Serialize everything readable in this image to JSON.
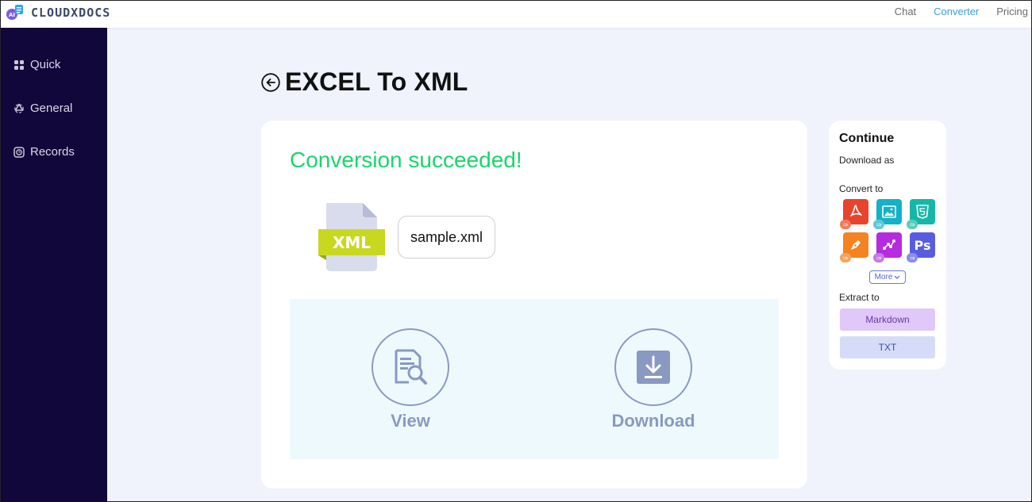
{
  "header": {
    "brand": "CLOUDXDOCS",
    "nav": [
      {
        "label": "Chat",
        "active": false
      },
      {
        "label": "Converter",
        "active": true
      },
      {
        "label": "Pricing",
        "active": false
      }
    ]
  },
  "sidebar": {
    "items": [
      {
        "label": "Quick",
        "icon": "grid-icon"
      },
      {
        "label": "General",
        "icon": "recycle-icon"
      },
      {
        "label": "Records",
        "icon": "clock-icon"
      }
    ]
  },
  "page": {
    "title": "EXCEL To XML"
  },
  "result": {
    "status": "Conversion succeeded!",
    "file_type": "XML",
    "file_name": "sample.xml",
    "view_label": "View",
    "download_label": "Download"
  },
  "panel": {
    "title": "Continue",
    "download_as": "Download as",
    "convert_to": "Convert to",
    "tools": [
      {
        "name": "pdf-tool",
        "icon": "pdf-icon",
        "color": "#e8432c",
        "badge": "#f07a5a"
      },
      {
        "name": "image-tool",
        "icon": "image-icon",
        "color": "#14b2c8",
        "badge": "#5fc8d8"
      },
      {
        "name": "html-tool",
        "icon": "html5-icon",
        "color": "#15b8a8",
        "badge": "#5ccabf"
      },
      {
        "name": "edit-tool",
        "icon": "pen-icon",
        "color": "#f5831f",
        "badge": "#f4a35e"
      },
      {
        "name": "vector-tool",
        "icon": "vector-icon",
        "color": "#b52be0",
        "badge": "#c47ae6"
      },
      {
        "name": "ps-tool",
        "icon": "photoshop-icon",
        "color": "#5a5ce0",
        "badge": "#8b8de8",
        "text": "Ps"
      }
    ],
    "more_label": "More",
    "extract_to": "Extract to",
    "extract_options": [
      {
        "label": "Markdown",
        "bg": "#e0c8f8",
        "fg": "#6a3aa8"
      },
      {
        "label": "TXT",
        "bg": "#d6dcf8",
        "fg": "#3b4bb8"
      }
    ]
  },
  "colors": {
    "sidebar_bg": "#12073a",
    "success": "#19d66a",
    "accent": "#3aa0d8",
    "action": "#8a99c2"
  }
}
